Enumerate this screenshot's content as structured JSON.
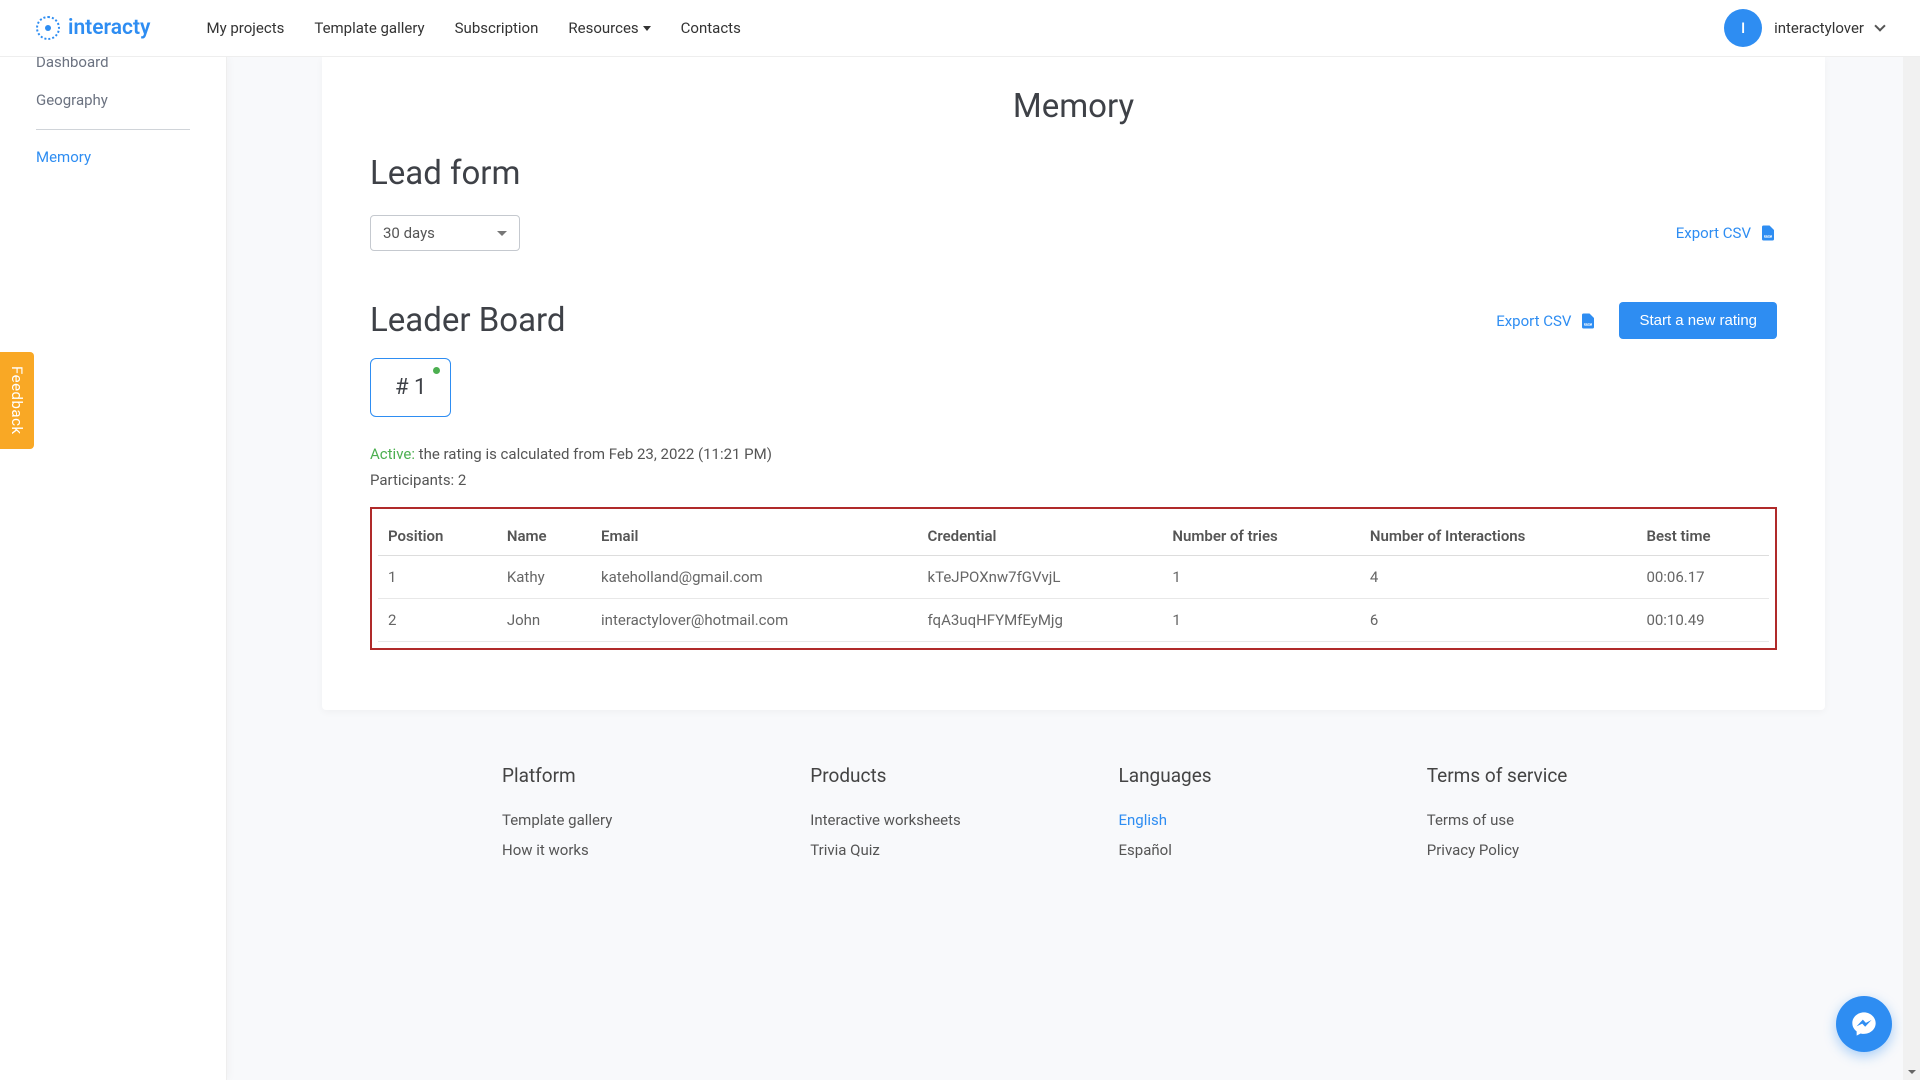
{
  "brand": "interacty",
  "nav": {
    "items": [
      "My projects",
      "Template gallery",
      "Subscription",
      "Resources",
      "Contacts"
    ]
  },
  "user": {
    "initial": "I",
    "name": "interactylover"
  },
  "sidebar": {
    "items": [
      "Dashboard",
      "Geography",
      "Memory"
    ]
  },
  "page": {
    "title": "Memory",
    "lead_form_title": "Lead form",
    "period_selected": "30 days",
    "export_csv": "Export CSV",
    "leaderboard_title": "Leader Board",
    "start_rating": "Start a new rating",
    "rating_badge": "# 1",
    "status_active": "Active:",
    "status_text": " the rating is calculated from Feb 23, 2022 (11:21 PM)",
    "participants": "Participants: 2"
  },
  "table": {
    "headers": [
      "Position",
      "Name",
      "Email",
      "Credential",
      "Number of tries",
      "Number of Interactions",
      "Best time"
    ],
    "rows": [
      {
        "position": "1",
        "name": "Kathy",
        "email": "kateholland@gmail.com",
        "credential": "kTeJPOXnw7fGVvjL",
        "tries": "1",
        "interactions": "4",
        "best_time": "00:06.17"
      },
      {
        "position": "2",
        "name": "John",
        "email": "interactylover@hotmail.com",
        "credential": "fqA3uqHFYMfEyMjg",
        "tries": "1",
        "interactions": "6",
        "best_time": "00:10.49"
      }
    ]
  },
  "footer": {
    "cols": [
      {
        "title": "Platform",
        "links": [
          "Template gallery",
          "How it works"
        ]
      },
      {
        "title": "Products",
        "links": [
          "Interactive worksheets",
          "Trivia Quiz"
        ]
      },
      {
        "title": "Languages",
        "links": [
          "English",
          "Español"
        ],
        "active": "English"
      },
      {
        "title": "Terms of service",
        "links": [
          "Terms of use",
          "Privacy Policy"
        ]
      }
    ]
  },
  "feedback": "Feedback"
}
